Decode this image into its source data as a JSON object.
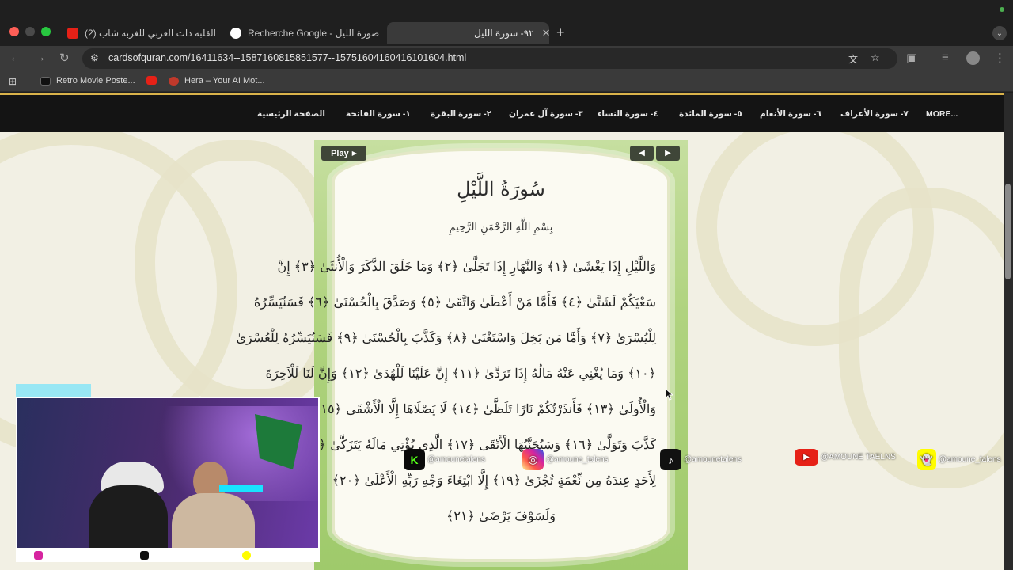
{
  "browser": {
    "tabs": [
      {
        "title": "(2) القلبة دات العربي للغربة شاب",
        "active": false
      },
      {
        "title": "Recherche Google - صورة الليل",
        "active": false
      },
      {
        "title": "٩٢- سورة الليل",
        "active": true
      }
    ],
    "new_tab_label": "+",
    "url": "cardsofquran.com/16411634--1587160815851577--15751604160416101604.html",
    "bookmarks": [
      {
        "label": "Retro Movie Poste..."
      },
      {
        "label": ""
      },
      {
        "label": "Hera – Your AI Mot..."
      }
    ]
  },
  "site": {
    "nav": [
      {
        "label": "MORE..."
      },
      {
        "label": "٧- سورة الأعراف"
      },
      {
        "label": "٦- سورة الأنعام"
      },
      {
        "label": "٥- سورة المائدة"
      },
      {
        "label": "٤- سورة النساء"
      },
      {
        "label": "٣- سورة آل عمران"
      },
      {
        "label": "٢- سورة البقرة"
      },
      {
        "label": "١- سورة الفاتحة"
      },
      {
        "label": "الصفحة الرئيسية"
      }
    ],
    "play_label": "Play",
    "prev_icon": "◀",
    "next_icon": "▶",
    "card": {
      "title": "سُورَةُ اللَّيْلِ",
      "basmala": "بِسْمِ اللَّهِ الرَّحْمَٰنِ الرَّحِيمِ",
      "ayahs": [
        "وَاللَّيْلِ إِذَا يَغْشَىٰ ﴿١﴾ وَالنَّهَارِ إِذَا تَجَلَّىٰ ﴿٢﴾ وَمَا خَلَقَ الذَّكَرَ وَالْأُنثَىٰ ﴿٣﴾ إِنَّ",
        "سَعْيَكُمْ لَشَتَّىٰ ﴿٤﴾ فَأَمَّا مَنْ أَعْطَىٰ وَاتَّقَىٰ ﴿٥﴾ وَصَدَّقَ بِالْحُسْنَىٰ ﴿٦﴾ فَسَنُيَسِّرُهُ",
        "لِلْيُسْرَىٰ ﴿٧﴾ وَأَمَّا مَن بَخِلَ وَاسْتَغْنَىٰ ﴿٨﴾ وَكَذَّبَ بِالْحُسْنَىٰ ﴿٩﴾ فَسَنُيَسِّرُهُ لِلْعُسْرَىٰ",
        "﴿١٠﴾ وَمَا يُغْنِي عَنْهُ مَالُهُ إِذَا تَرَدَّىٰ ﴿١١﴾ إِنَّ عَلَيْنَا لَلْهُدَىٰ ﴿١٢﴾ وَإِنَّ لَنَا لَلْآخِرَةَ",
        "وَالْأُولَىٰ ﴿١٣﴾ فَأَنذَرْتُكُمْ نَارًا تَلَظَّىٰ ﴿١٤﴾ لَا يَصْلَاهَا إِلَّا الْأَشْقَى ﴿١٥﴾ الَّذِي",
        "كَذَّبَ وَتَوَلَّىٰ ﴿١٦﴾ وَسَيُجَنَّبُهَا الْأَتْقَى ﴿١٧﴾ الَّذِي يُؤْتِي مَالَهُ يَتَزَكَّىٰ ﴿١٨﴾ وَمَا",
        "لِأَحَدٍ عِندَهُ مِن نِّعْمَةٍ تُجْزَىٰ ﴿١٩﴾ إِلَّا ابْتِغَاءَ وَجْهِ رَبِّهِ الْأَعْلَىٰ ﴿٢٠﴾",
        "وَلَسَوْفَ يَرْضَىٰ ﴿٢١﴾"
      ]
    }
  },
  "overlay": {
    "socials": [
      {
        "platform": "kick",
        "handle": "@amounetalens",
        "color": "#0a0a0a",
        "icon": "K"
      },
      {
        "platform": "instagram",
        "handle": "@amoune_talens",
        "color": "#d6249f",
        "icon": "◎"
      },
      {
        "platform": "tiktok",
        "handle": "@amounetalens",
        "color": "#111111",
        "icon": "♪"
      },
      {
        "platform": "youtube",
        "handle": "@AMOUNE TAELNS",
        "color": "#e62117",
        "icon": "▶"
      },
      {
        "platform": "snapchat",
        "handle": "@amoune_talens",
        "color": "#fffc00",
        "icon": "👻"
      }
    ]
  },
  "colors": {
    "accent_gold": "#d9b24a",
    "nav_bg": "#141414",
    "card_green": "#b0d37f"
  }
}
